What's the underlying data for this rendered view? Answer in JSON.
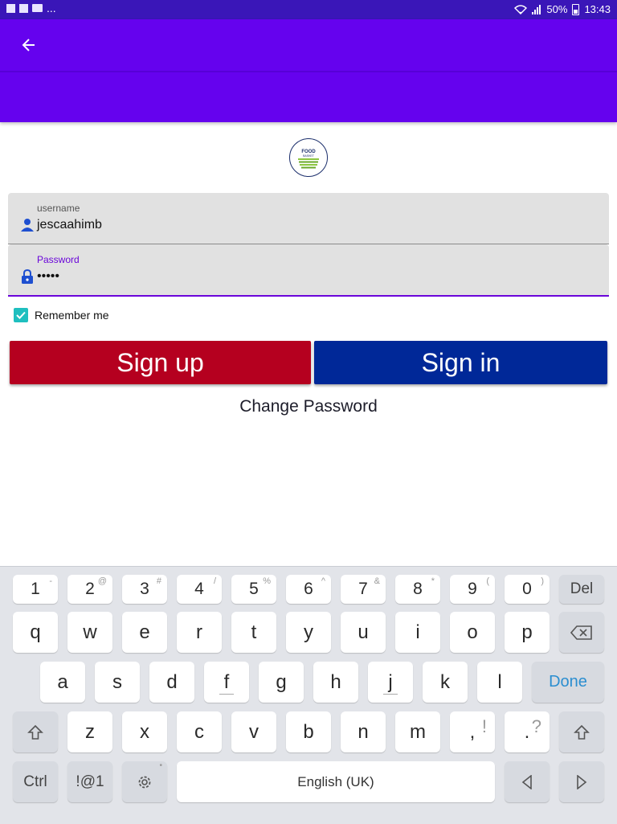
{
  "status_bar": {
    "left_dots": "...",
    "battery": "50%",
    "time": "13:43"
  },
  "form": {
    "username_label": "username",
    "username_value": "jescaahimb",
    "password_label": "Password",
    "password_value": "•••••",
    "remember_label": "Remember me"
  },
  "buttons": {
    "signup": "Sign up",
    "signin": "Sign in",
    "change_password": "Change Password"
  },
  "keyboard": {
    "numbers": [
      {
        "main": "1",
        "sup": "-"
      },
      {
        "main": "2",
        "sup": "@"
      },
      {
        "main": "3",
        "sup": "#"
      },
      {
        "main": "4",
        "sup": "/"
      },
      {
        "main": "5",
        "sup": "%"
      },
      {
        "main": "6",
        "sup": "^"
      },
      {
        "main": "7",
        "sup": "&"
      },
      {
        "main": "8",
        "sup": "*"
      },
      {
        "main": "9",
        "sup": "("
      },
      {
        "main": "0",
        "sup": ")"
      }
    ],
    "del": "Del",
    "row_q": [
      "q",
      "w",
      "e",
      "r",
      "t",
      "y",
      "u",
      "i",
      "o",
      "p"
    ],
    "row_a": [
      "a",
      "s",
      "d",
      "f",
      "g",
      "h",
      "j",
      "k",
      "l"
    ],
    "done": "Done",
    "row_z": [
      "z",
      "x",
      "c",
      "v",
      "b",
      "n",
      "m"
    ],
    "comma": {
      "main": ",",
      "sup": "!"
    },
    "period": {
      "main": ".",
      "sup": "?"
    },
    "ctrl": "Ctrl",
    "sym": "!@1",
    "space": "English (UK)"
  },
  "colors": {
    "appbar": "#6502ee",
    "signup": "#b5001f",
    "signin": "#002898",
    "checkbox": "#1fbfbf"
  }
}
